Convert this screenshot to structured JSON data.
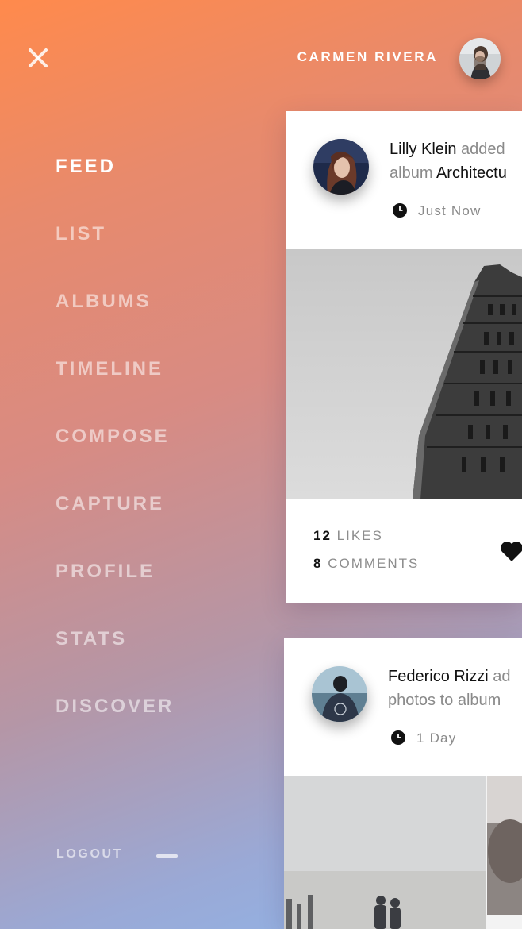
{
  "header": {
    "user_name": "CARMEN RIVERA"
  },
  "nav": {
    "items": [
      "FEED",
      "LIST",
      "ALBUMS",
      "TIMELINE",
      "COMPOSE",
      "CAPTURE",
      "PROFILE",
      "STATS",
      "DISCOVER"
    ],
    "active": "FEED",
    "logout_label": "LOGOUT"
  },
  "feed": {
    "posts": [
      {
        "author": "Lilly Klein",
        "action": "added",
        "line2_prefix": "album",
        "album": "Architectu",
        "time": "Just Now",
        "likes_count": "12",
        "likes_label": "LIKES",
        "comments_count": "8",
        "comments_label": "COMMENTS"
      },
      {
        "author": "Federico Rizzi",
        "action": "ad",
        "line2": "photos to album",
        "time": "1 Day"
      }
    ]
  },
  "icons": {
    "close": "close-icon",
    "clock": "clock-icon",
    "heart": "heart-icon"
  },
  "colors": {
    "gradient_top": "#ff8a4c",
    "gradient_bottom": "#8fb6ea",
    "card_bg": "#ffffff"
  }
}
